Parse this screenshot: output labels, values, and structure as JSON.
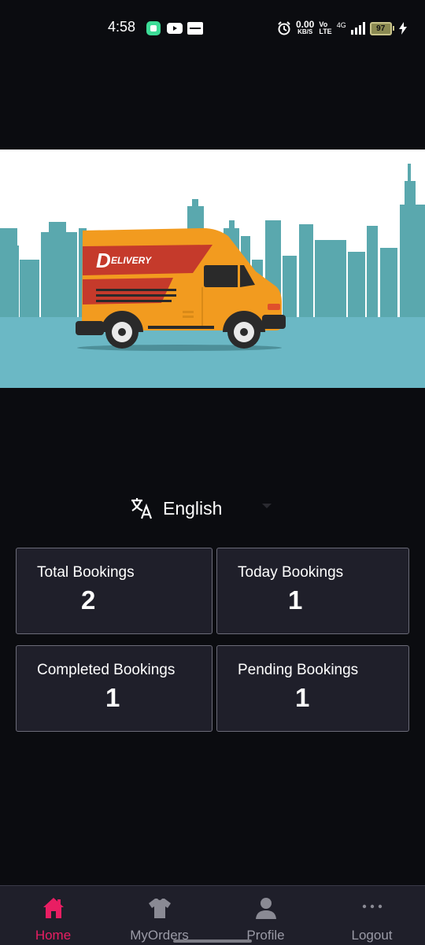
{
  "status_bar": {
    "time": "4:58",
    "speed_value": "0.00",
    "speed_unit": "KB/S",
    "volte_top": "Vo",
    "volte_bottom": "LTE",
    "network": "4G",
    "battery": "97"
  },
  "banner": {
    "van_text": "ELIVERY",
    "van_initial": "D"
  },
  "language": {
    "label": "English",
    "icon": "translate-icon"
  },
  "stats": [
    {
      "title": "Total Bookings",
      "value": "2"
    },
    {
      "title": "Today Bookings",
      "value": "1"
    },
    {
      "title": "Completed Bookings",
      "value": "1"
    },
    {
      "title": "Pending Bookings",
      "value": "1"
    }
  ],
  "bottom_nav": [
    {
      "label": "Home",
      "icon": "home-icon",
      "active": true
    },
    {
      "label": "MyOrders",
      "icon": "shirt-icon",
      "active": false
    },
    {
      "label": "Profile",
      "icon": "person-icon",
      "active": false
    },
    {
      "label": "Logout",
      "icon": "more-dots-icon",
      "active": false
    }
  ],
  "colors": {
    "background": "#0b0c10",
    "card": "#1f1f2a",
    "accent": "#e91e63",
    "van_body": "#f29b1f",
    "van_stripe": "#c53a2b",
    "skyline": "#5aa8ae",
    "road": "#6bb8c5"
  }
}
